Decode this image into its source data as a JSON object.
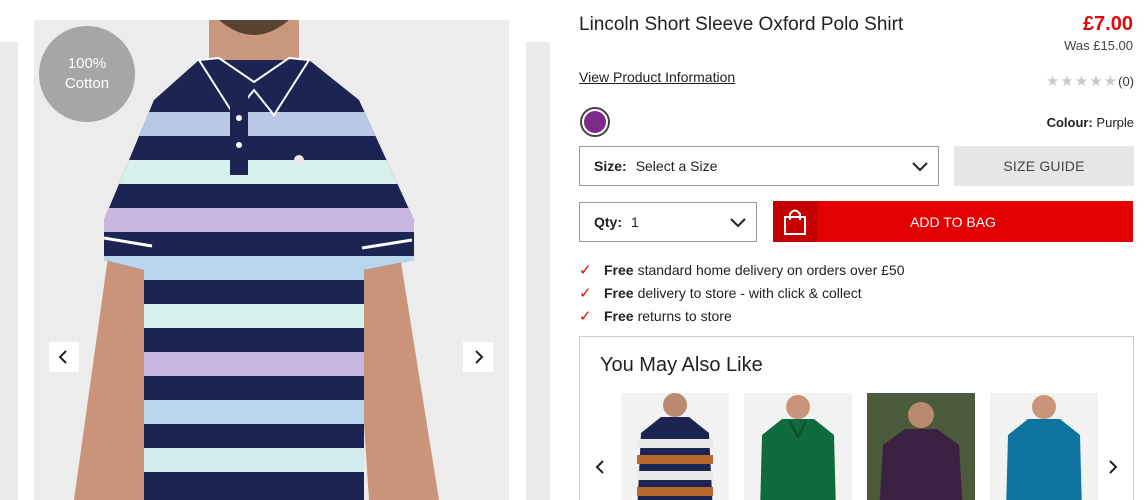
{
  "badge": {
    "line1": "100%",
    "line2": "Cotton"
  },
  "product": {
    "title": "Lincoln Short Sleeve Oxford Polo Shirt",
    "view_info": "View Product Information",
    "price": "£7.00",
    "was_price": "Was £15.00",
    "rating_count": "(0)",
    "stars": 0,
    "colour_label": "Colour:",
    "colour_value": "Purple",
    "swatch_color": "#7d2b8b"
  },
  "size": {
    "label": "Size:",
    "value": "Select a Size"
  },
  "size_guide": "SIZE GUIDE",
  "qty": {
    "label": "Qty:",
    "value": "1"
  },
  "add_to_bag": "ADD TO BAG",
  "delivery": [
    {
      "bold": "Free",
      "text": "standard home delivery on orders over £50"
    },
    {
      "bold": "Free",
      "text": "delivery to store - with click & collect"
    },
    {
      "bold": "Free",
      "text": "returns to store"
    }
  ],
  "also_like": {
    "title": "You May Also Like"
  },
  "colors": {
    "accent": "#e20000",
    "price": "#e10a0a"
  }
}
